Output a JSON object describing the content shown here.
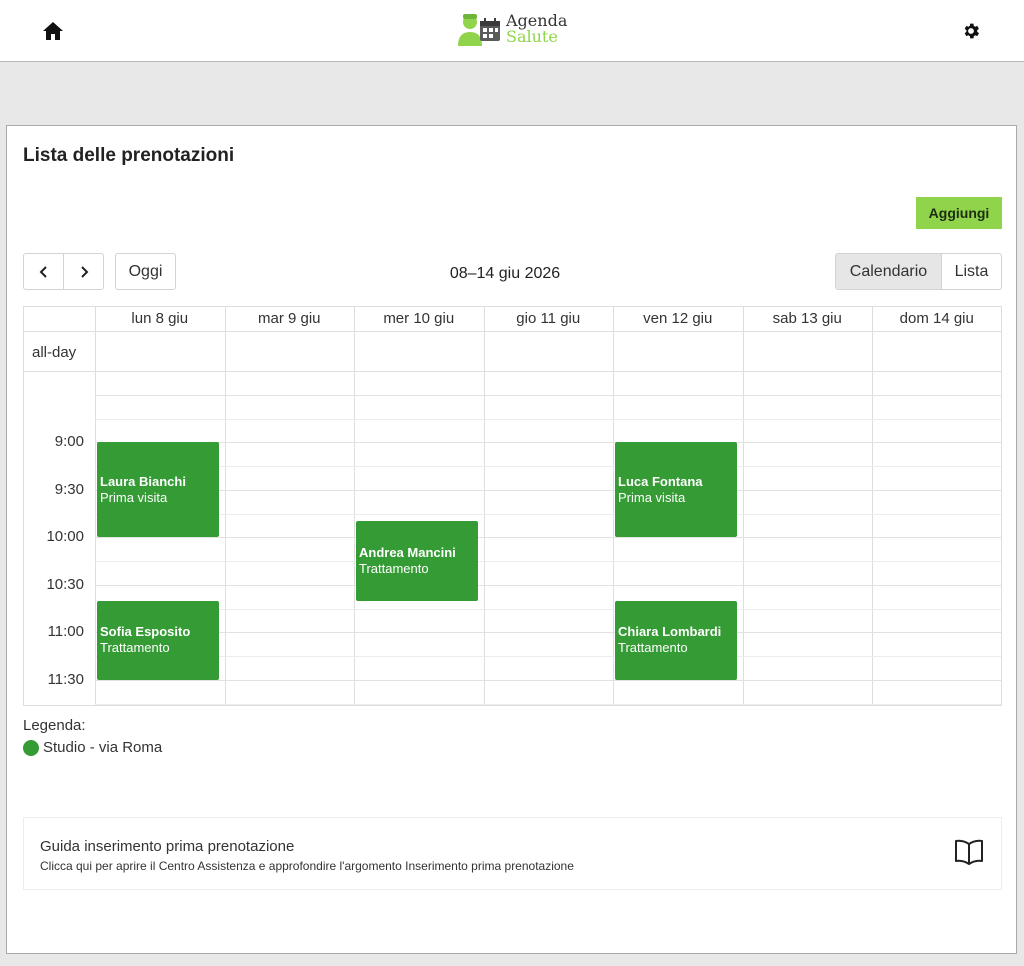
{
  "app": {
    "logo_word1": "Agenda",
    "logo_word2": "Salute",
    "logo_icon": "doctor-calendar-icon",
    "home_icon": "home-icon",
    "settings_icon": "gear-icon",
    "accent_color": "#8fd44a"
  },
  "page": {
    "title": "Lista delle prenotazioni",
    "add_button": "Aggiungi"
  },
  "toolbar": {
    "prev_icon": "chevron-left-icon",
    "next_icon": "chevron-right-icon",
    "today": "Oggi",
    "range": "08–14 giu 2026",
    "views": [
      "Calendario",
      "Lista"
    ],
    "active_view": "Calendario"
  },
  "calendar": {
    "allday_label": "all-day",
    "days": [
      "lun 8 giu",
      "mar 9 giu",
      "mer 10 giu",
      "gio 11 giu",
      "ven 12 giu",
      "sab 13 giu",
      "dom 14 giu"
    ],
    "times": [
      "9:00",
      "9:30",
      "10:00",
      "10:30",
      "11:00",
      "11:30"
    ],
    "event_color": "#359b35",
    "events": [
      {
        "day": 0,
        "start": "9:00",
        "end": "10:00",
        "name": "Laura Bianchi",
        "type": "Prima visita"
      },
      {
        "day": 4,
        "start": "9:00",
        "end": "10:00",
        "name": "Luca Fontana",
        "type": "Prima visita"
      },
      {
        "day": 2,
        "start": "9:50",
        "end": "10:40",
        "name": "Andrea Mancini",
        "type": "Trattamento"
      },
      {
        "day": 0,
        "start": "10:40",
        "end": "11:30",
        "name": "Sofia Esposito",
        "type": "Trattamento"
      },
      {
        "day": 4,
        "start": "10:40",
        "end": "11:30",
        "name": "Chiara Lombardi",
        "type": "Trattamento"
      }
    ]
  },
  "legend": {
    "title": "Legenda:",
    "items": [
      {
        "label": "Studio - via Roma",
        "color": "#359b35"
      }
    ]
  },
  "help": {
    "title": "Guida inserimento prima prenotazione",
    "description": "Clicca qui per aprire il Centro Assistenza e approfondire l'argomento Inserimento prima prenotazione",
    "icon": "book-icon"
  }
}
